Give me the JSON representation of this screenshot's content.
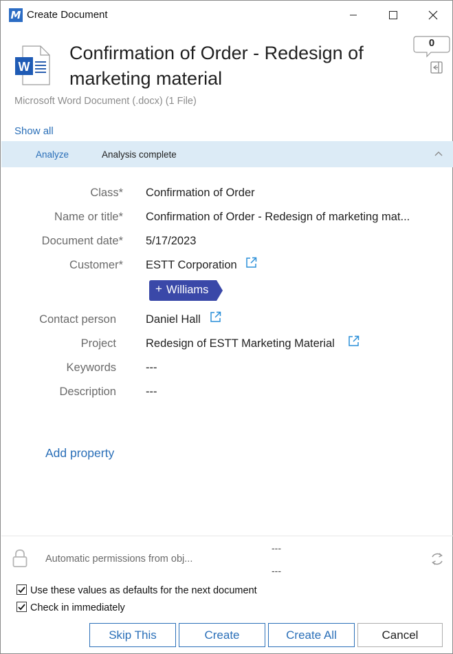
{
  "window": {
    "app_logo_letter": "M",
    "title": "Create Document"
  },
  "header": {
    "doc_icon_letter": "W",
    "title": "Confirmation of Order - Redesign of marketing material",
    "subtitle": "Microsoft Word Document (.docx) (1 File)",
    "comment_count": "0",
    "show_all": "Show all"
  },
  "analyze": {
    "link": "Analyze",
    "status": "Analysis complete"
  },
  "properties": [
    {
      "label": "Class*",
      "value": "Confirmation of Order"
    },
    {
      "label": "Name or title*",
      "value": "Confirmation of Order - Redesign of marketing mat..."
    },
    {
      "label": "Document date*",
      "value": "5/17/2023"
    },
    {
      "label": "Customer*",
      "value": "ESTT Corporation"
    },
    {
      "label": "Contact person",
      "value": "Daniel Hall"
    },
    {
      "label": "Project",
      "value": "Redesign of ESTT Marketing Material"
    },
    {
      "label": "Keywords",
      "value": "---"
    },
    {
      "label": "Description",
      "value": "---"
    }
  ],
  "tag": {
    "plus": "+",
    "label": "Williams",
    "color": "#3a48a8"
  },
  "add_property": "Add property",
  "footer": {
    "permissions_text": "Automatic permissions from obj...",
    "permissions_dash_1": "---",
    "permissions_dash_2": "---",
    "checkbox_defaults": {
      "label": "Use these values as defaults for the next document",
      "checked": true
    },
    "checkbox_checkin": {
      "label": "Check in immediately",
      "checked": true
    }
  },
  "buttons": {
    "skip": "Skip This",
    "create": "Create",
    "create_all": "Create All",
    "cancel": "Cancel"
  },
  "colors": {
    "accent": "#2a6fb8",
    "analyze_bar": "#dcebf6"
  }
}
